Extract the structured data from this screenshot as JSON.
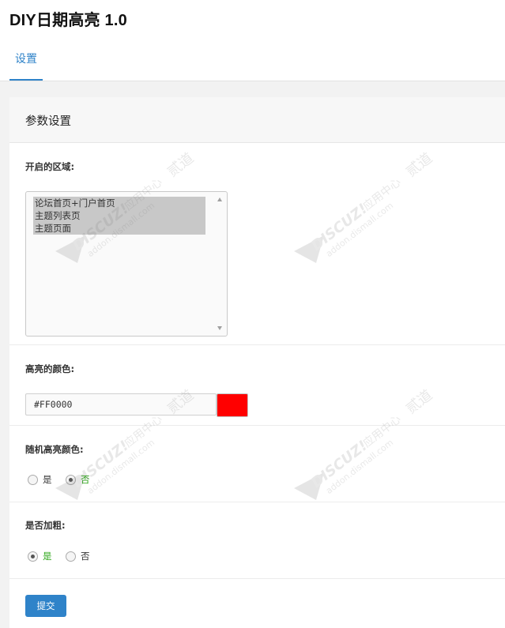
{
  "app": {
    "title": "DIY日期高亮 1.0"
  },
  "tabs": [
    {
      "label": "设置",
      "active": true
    }
  ],
  "panel": {
    "title": "参数设置"
  },
  "fields": {
    "areas": {
      "label": "开启的区域:",
      "options": [
        "论坛首页+门户首页",
        "主题列表页",
        "主题页面"
      ],
      "selected": [
        true,
        true,
        true
      ]
    },
    "highlight_color": {
      "label": "高亮的颜色:",
      "value": "#FF0000",
      "swatch_color": "#ff0000"
    },
    "random_color": {
      "label": "随机高亮颜色:",
      "options": [
        "是",
        "否"
      ],
      "selected": "否"
    },
    "bold": {
      "label": "是否加粗:",
      "options": [
        "是",
        "否"
      ],
      "selected": "是"
    }
  },
  "actions": {
    "submit_label": "提交"
  },
  "watermark": {
    "brand": "DISCUZ!",
    "center": "应用中心",
    "suffix": "贰道",
    "url": "addon.dismall.com"
  },
  "colors": {
    "accent": "#2f83c9",
    "checked_text": "#2aa515",
    "band": "#f2f2f2"
  }
}
